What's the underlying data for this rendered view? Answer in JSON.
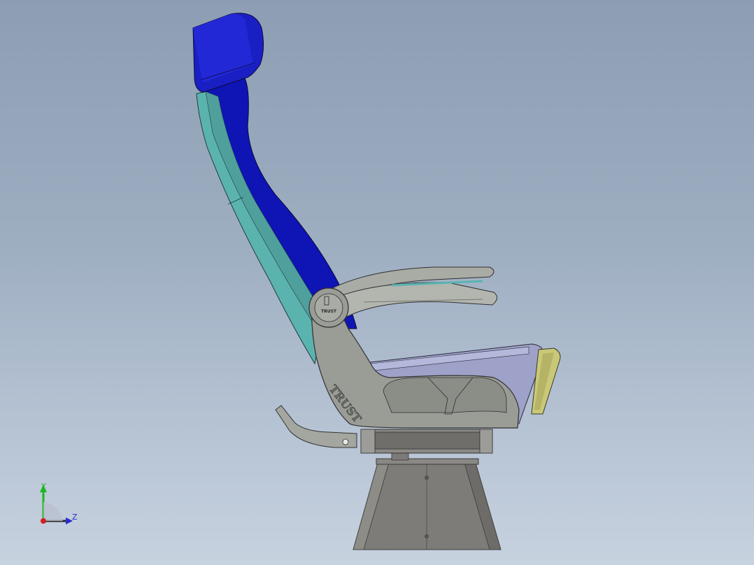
{
  "viewport": {
    "background_top": "#8d9db3",
    "background_bottom": "#c7d2df"
  },
  "model": {
    "brand_text": "TRUST",
    "armrest_badge_text": "TRUST",
    "colors": {
      "headrest_blue": "#1a1fc4",
      "back_blue": "#0f14b5",
      "back_panel_teal": "#5bb3b0",
      "frame_gray": "#9a9c96",
      "cushion_lavender": "#9ea2c8",
      "footrest_yellow": "#c9c878",
      "pedestal_gray": "#7e7c78"
    }
  },
  "triad": {
    "y_label": "Y",
    "z_label": "Z",
    "y_color": "#1fb51f",
    "z_color": "#2a2ad0",
    "x_color": "#d41f1f"
  }
}
